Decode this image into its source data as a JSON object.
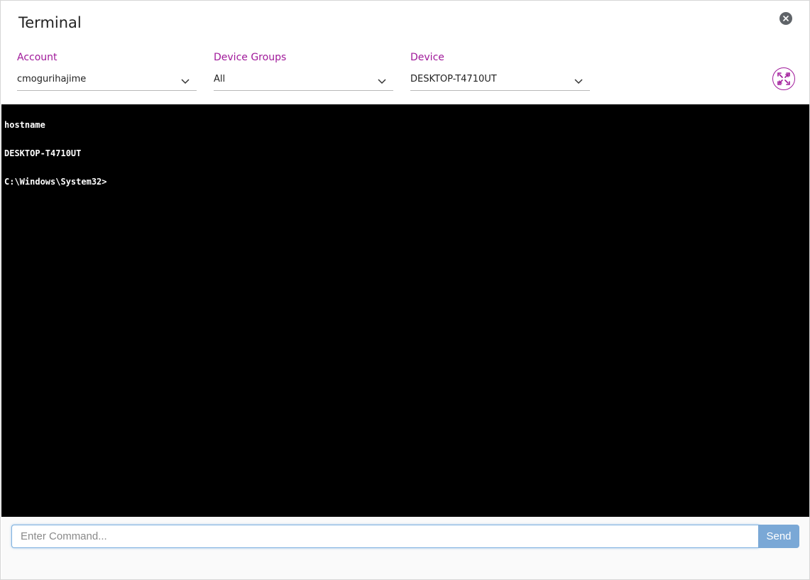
{
  "modal": {
    "title": "Terminal"
  },
  "filters": {
    "account": {
      "label": "Account",
      "value": "cmogurihajime"
    },
    "device_groups": {
      "label": "Device Groups",
      "value": "All"
    },
    "device": {
      "label": "Device",
      "value": "DESKTOP-T4710UT"
    }
  },
  "terminal": {
    "lines": [
      "hostname",
      "DESKTOP-T4710UT",
      "C:\\Windows\\System32>"
    ]
  },
  "command": {
    "placeholder": "Enter Command...",
    "value": "",
    "send_label": "Send"
  },
  "icons": {
    "close": "close-icon",
    "chevron": "chevron-down-icon",
    "expand": "expand-icon"
  },
  "colors": {
    "accent": "#a0199a",
    "terminal_bg": "#000000",
    "send_button": "#7aa8d6"
  }
}
